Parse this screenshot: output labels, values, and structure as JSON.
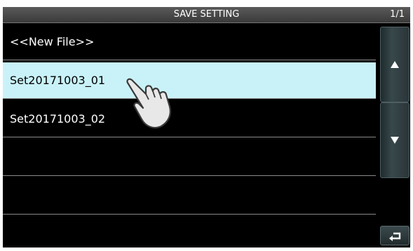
{
  "header": {
    "title": "SAVE SETTING",
    "page": "1/1"
  },
  "list": {
    "items": [
      {
        "label": "<<New File>>"
      },
      {
        "label": "Set20171003_01"
      },
      {
        "label": "Set20171003_02"
      },
      {
        "label": ""
      },
      {
        "label": ""
      },
      {
        "label": ""
      }
    ],
    "selected_index": 1
  },
  "controls": {
    "scroll_up_icon": "up-triangle-icon",
    "scroll_down_icon": "down-triangle-icon",
    "back_icon": "return-arrow-icon"
  },
  "colors": {
    "background": "#000000",
    "selected_row": "#c9f2f8",
    "text": "#ffffff"
  }
}
